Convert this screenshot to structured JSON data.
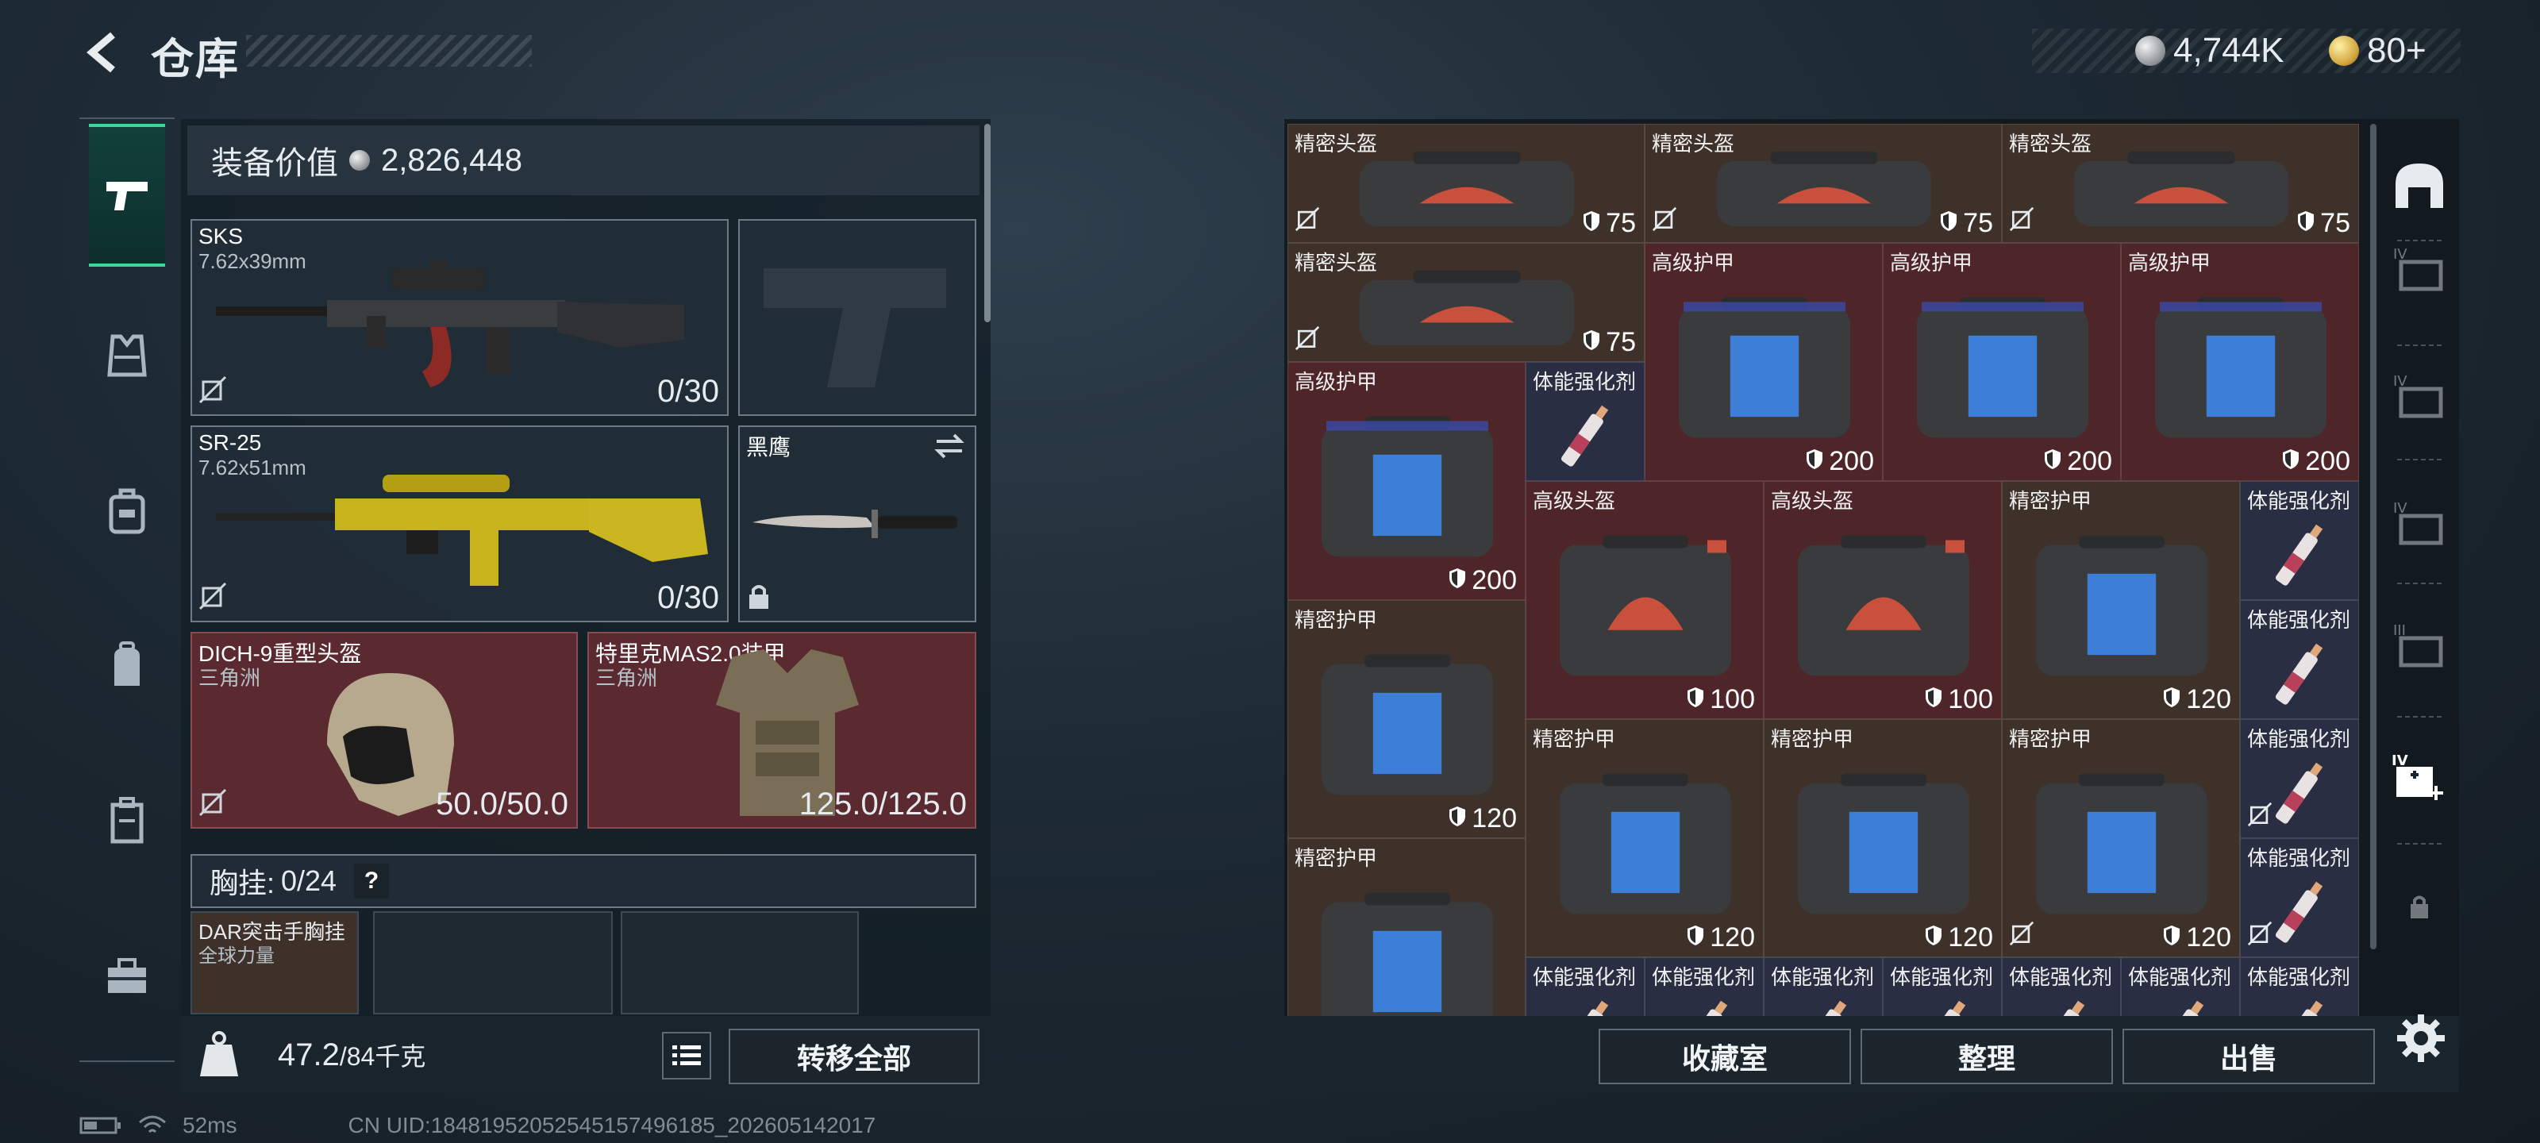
{
  "header": {
    "title": "仓库",
    "currency_silver": "4,744K",
    "currency_gold": "80+"
  },
  "loadout": {
    "equip_value_label": "装备价值",
    "equip_value": "2,826,448",
    "primary": {
      "name": "SKS",
      "caliber": "7.62x39mm",
      "ammo": "0/30"
    },
    "secondary": {
      "name": "SR-25",
      "caliber": "7.62x51mm",
      "ammo": "0/30"
    },
    "melee": {
      "name": "黑鹰"
    },
    "helmet": {
      "name": "DICH-9重型头盔",
      "origin": "三角洲",
      "durability": "50.0/50.0"
    },
    "armor": {
      "name": "特里克MAS2.0装甲",
      "origin": "三角洲",
      "durability": "125.0/125.0"
    },
    "rig": {
      "label": "胸挂:",
      "count": "0/24",
      "help": "?",
      "item_name": "DAR突击手胸挂",
      "item_sub": "全球力量"
    },
    "weight": "47.2",
    "weight_max": "/84千克",
    "transfer_all": "转移全部"
  },
  "storage": {
    "labels": {
      "precision_helmet": "精密头盔",
      "advanced_armor": "高级护甲",
      "advanced_helmet": "高级头盔",
      "precision_armor": "精密护甲",
      "stim": "体能强化剂"
    },
    "durability": {
      "d75": "75",
      "d200": "200",
      "d100": "100",
      "d120": "120"
    },
    "buttons": {
      "collection": "收藏室",
      "organize": "整理",
      "sell": "出售"
    }
  },
  "status": {
    "ping": "52ms",
    "uid": "CN UID:18481952052545157496185_202605142017"
  },
  "colors": {
    "accent": "#41d39a",
    "red_slot": "#4e262a",
    "brown_slot": "#3e3129",
    "blue_slot": "#2a2e43"
  },
  "icons": [
    "back-arrow-icon",
    "silver-coin-icon",
    "gold-coin-icon",
    "pistol-icon",
    "vest-icon",
    "backpack-icon",
    "pouch-icon",
    "case-icon",
    "toolbox-icon",
    "no-insure-icon",
    "shield-icon",
    "swap-icon",
    "lock-icon",
    "weight-icon",
    "list-icon",
    "settings-gear-icon"
  ]
}
